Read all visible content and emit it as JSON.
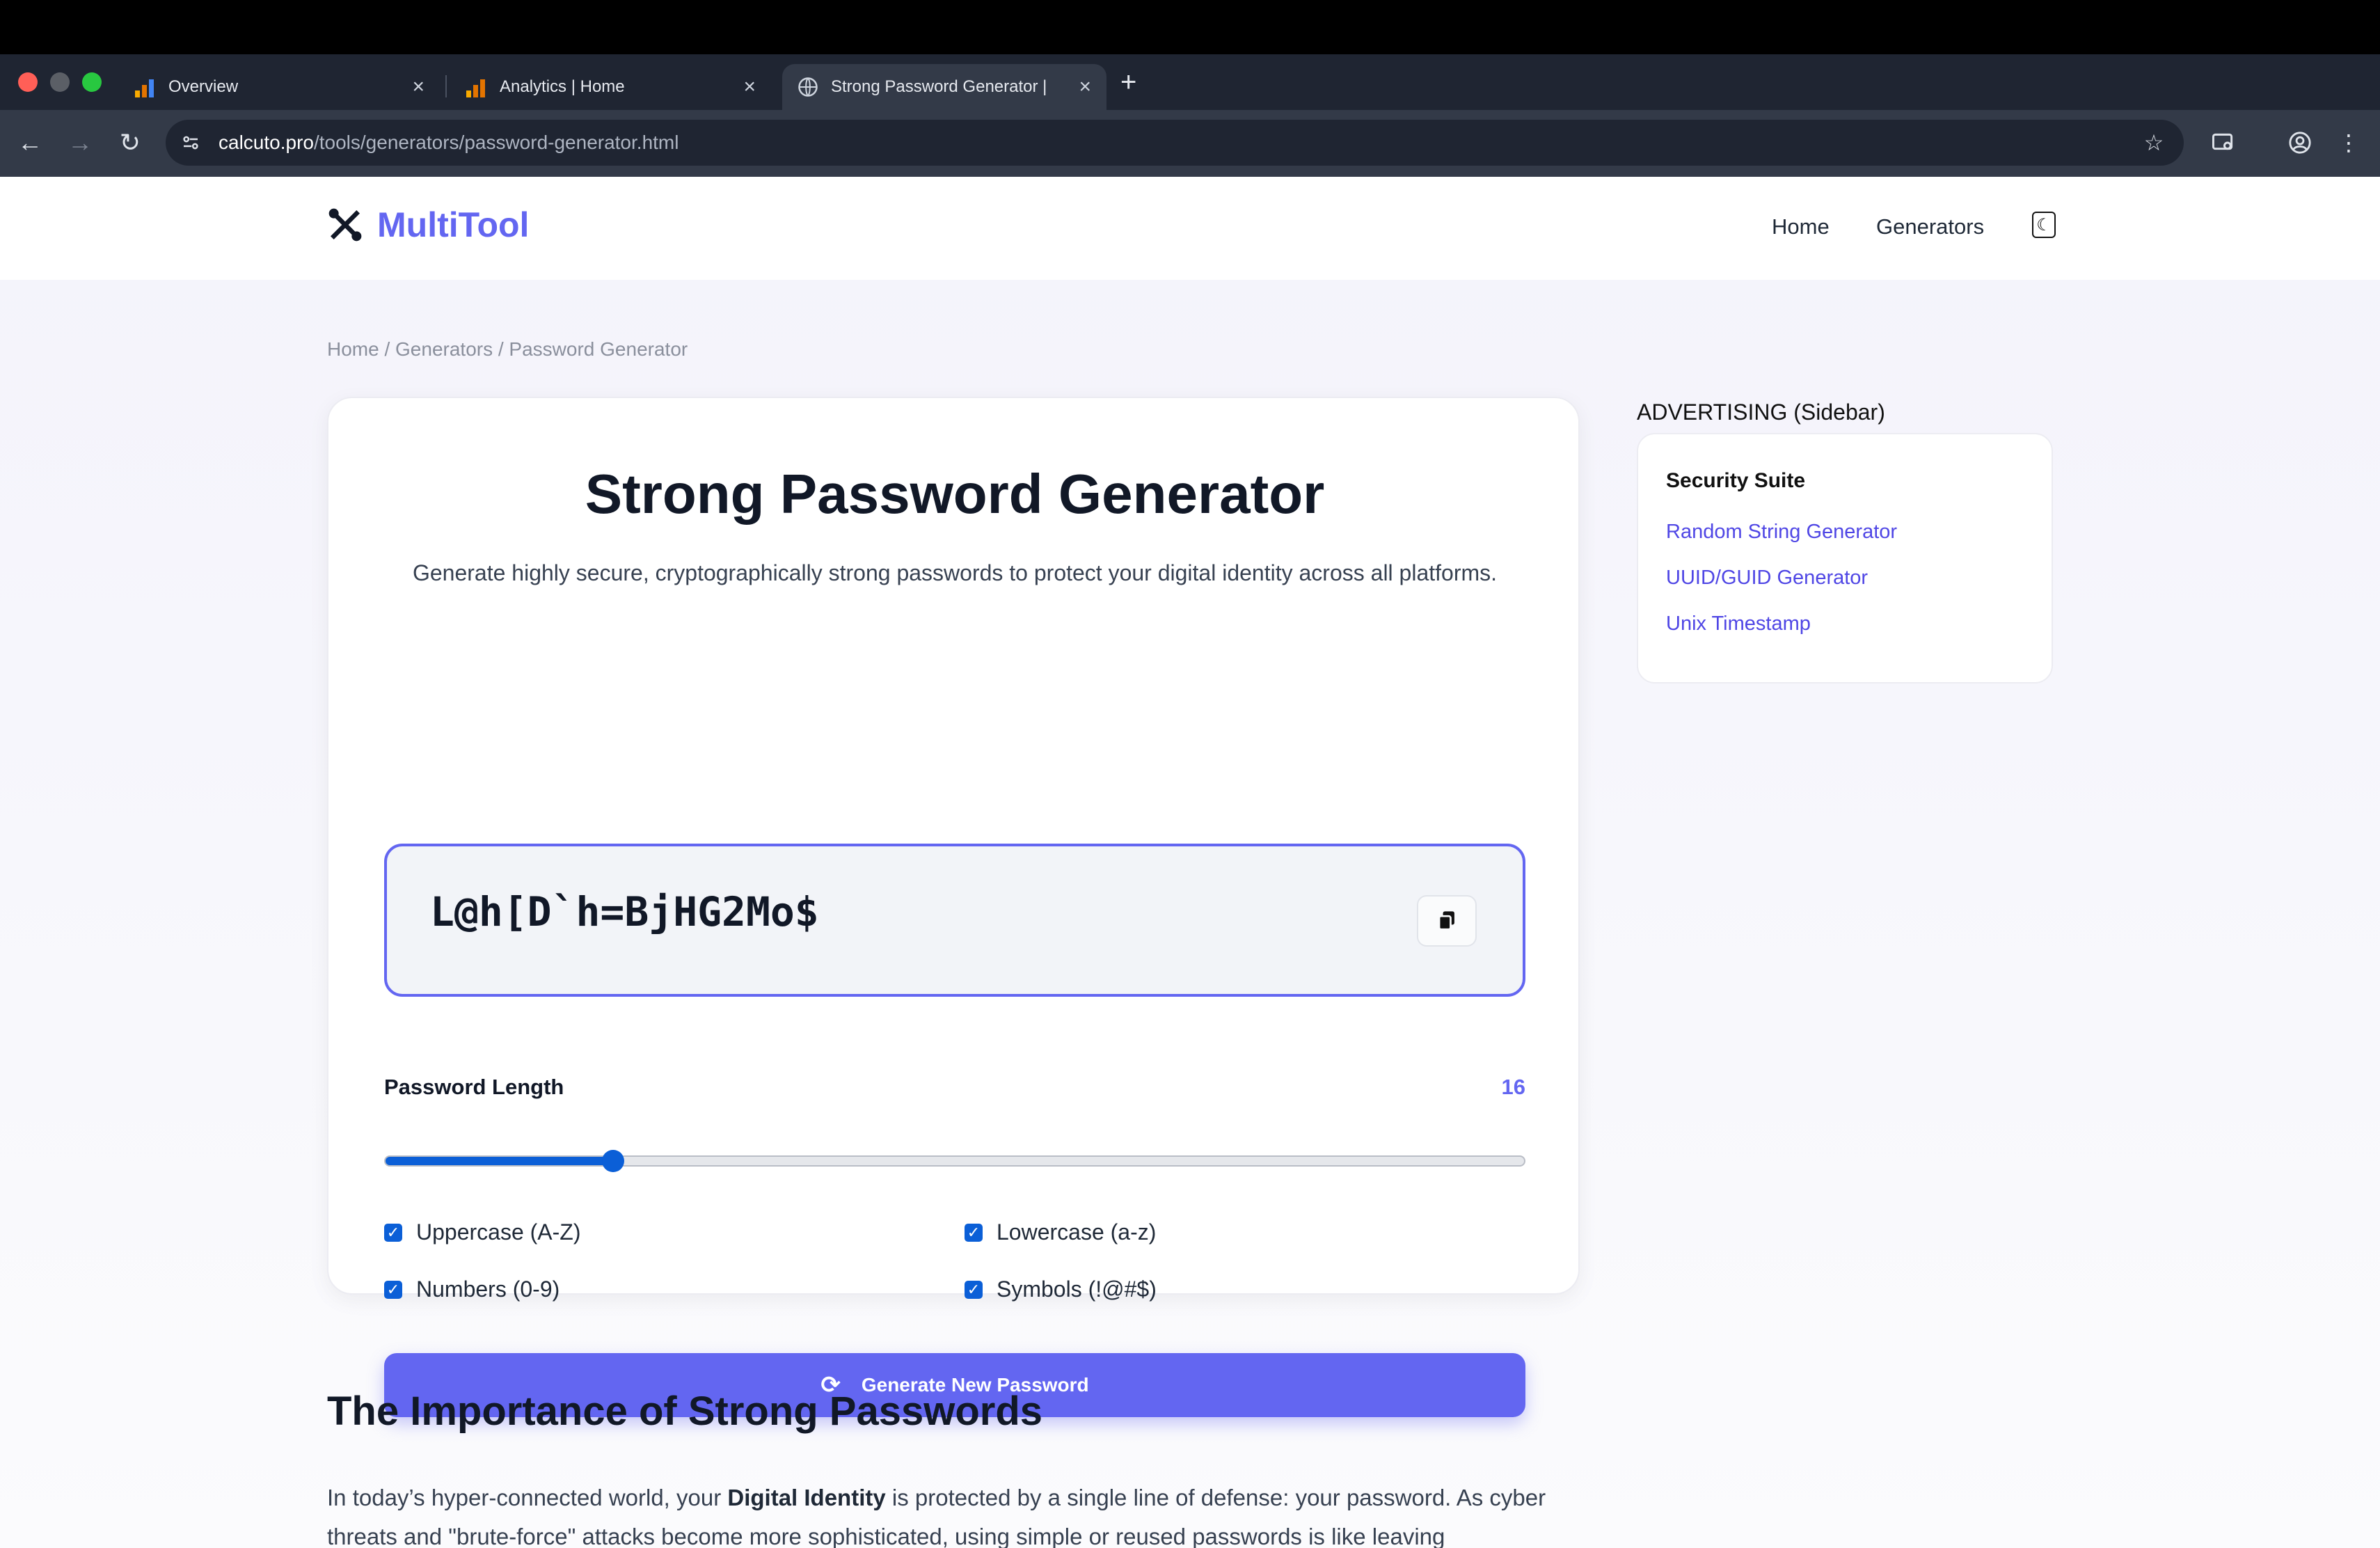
{
  "browser": {
    "tabs": [
      {
        "title": "Overview",
        "active": false
      },
      {
        "title": "Analytics | Home",
        "active": false
      },
      {
        "title": "Strong Password Generator |",
        "active": true
      }
    ],
    "url_host": "calcuto.pro",
    "url_path": "/tools/generators/password-generator.html"
  },
  "header": {
    "logo_text": "MultiTool",
    "nav": [
      "Home",
      "Generators"
    ]
  },
  "breadcrumb": "Home / Generators / Password Generator",
  "tool": {
    "title": "Strong Password Generator",
    "description": "Generate highly secure, cryptographically strong passwords to protect your digital identity across all platforms.",
    "password": "L@h[D`h=BjHG2Mo$",
    "length_label": "Password Length",
    "length_value": "16",
    "length_min": 4,
    "length_max": 64,
    "options": [
      {
        "label": "Uppercase (A-Z)",
        "checked": true
      },
      {
        "label": "Lowercase (a-z)",
        "checked": true
      },
      {
        "label": "Numbers (0-9)",
        "checked": true
      },
      {
        "label": "Symbols (!@#$)",
        "checked": true
      }
    ],
    "generate_label": "Generate New Password"
  },
  "sidebar": {
    "ad_label": "ADVERTISING (Sidebar)",
    "title": "Security Suite",
    "links": [
      "Random String Generator",
      "UUID/GUID Generator",
      "Unix Timestamp"
    ]
  },
  "article": {
    "heading": "The Importance of Strong Passwords",
    "p1_start": "In today’s hyper-connected world, your ",
    "p1_bold": "Digital Identity",
    "p1_end": " is protected by a single line of defense: your password. As cyber threats and \"brute-force\" attacks become more sophisticated, using simple or reused passwords is like leaving"
  },
  "colors": {
    "accent": "#6366f1",
    "checkbox": "#0b5fd7",
    "browser_bg": "#1f2532"
  }
}
